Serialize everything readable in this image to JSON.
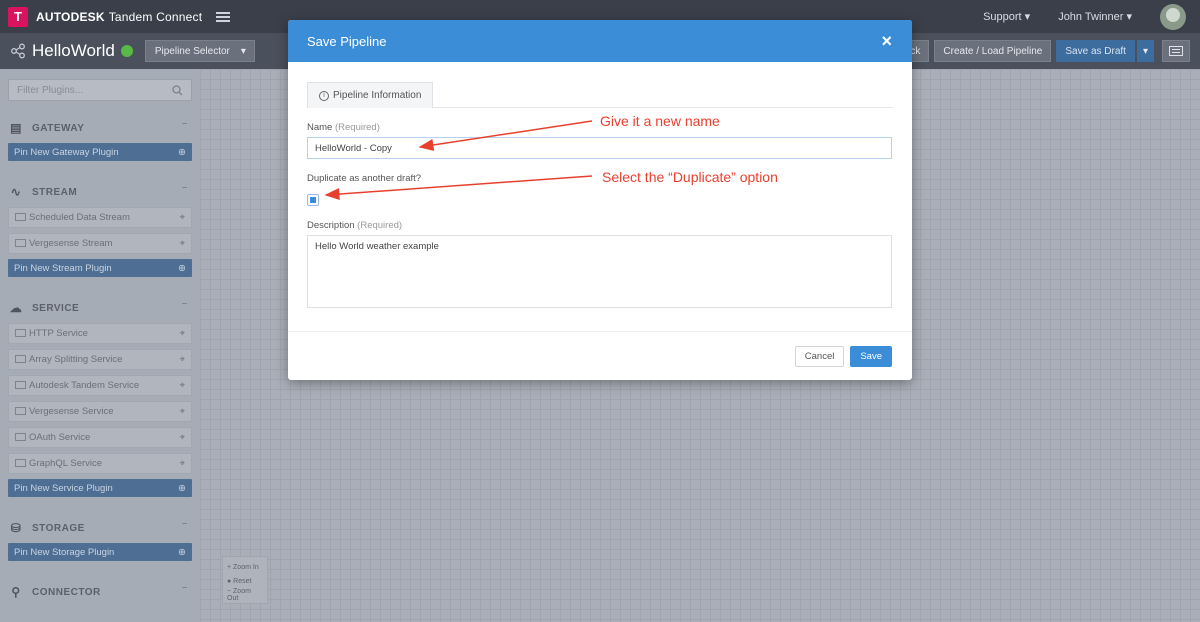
{
  "app": {
    "brand_bold": "AUTODESK",
    "brand_name": "Tandem Connect",
    "logo_letter": "T"
  },
  "topbar": {
    "support": "Support ▾",
    "user": "John Twinner ▾"
  },
  "subbar": {
    "pipeline_name": "HelloWorld",
    "selector": "Pipeline Selector",
    "back": "Back",
    "create_load": "Create / Load Pipeline",
    "save_draft": "Save as Draft",
    "dropdown": "▾"
  },
  "sidebar": {
    "filter_placeholder": "Filter Plugins...",
    "gateway": {
      "title": "GATEWAY",
      "pin": "Pin New Gateway Plugin"
    },
    "stream": {
      "title": "STREAM",
      "items": [
        "Scheduled Data Stream",
        "Vergesense Stream"
      ],
      "pin": "Pin New Stream Plugin"
    },
    "service": {
      "title": "SERVICE",
      "items": [
        "HTTP Service",
        "Array Splitting Service",
        "Autodesk Tandem Service",
        "Vergesense Service",
        "OAuth Service",
        "GraphQL Service"
      ],
      "pin": "Pin New Service Plugin"
    },
    "storage": {
      "title": "STORAGE",
      "pin": "Pin New Storage Plugin"
    },
    "connector": {
      "title": "CONNECTOR"
    }
  },
  "zoom": {
    "zoom_in": "+ Zoom In",
    "reset": "● Reset",
    "zoom_out": "− Zoom Out"
  },
  "modal": {
    "title": "Save Pipeline",
    "close": "×",
    "tab": "Pipeline Information",
    "name_label": "Name",
    "required": "(Required)",
    "name_value": "HelloWorld - Copy",
    "duplicate_label": "Duplicate as another draft?",
    "duplicate_checked": true,
    "description_label": "Description",
    "description_value": "Hello World weather example",
    "cancel": "Cancel",
    "save": "Save"
  },
  "annotations": {
    "name_hint": "Give it a new name",
    "duplicate_hint": "Select the “Duplicate” option",
    "color": "#e8402f"
  }
}
